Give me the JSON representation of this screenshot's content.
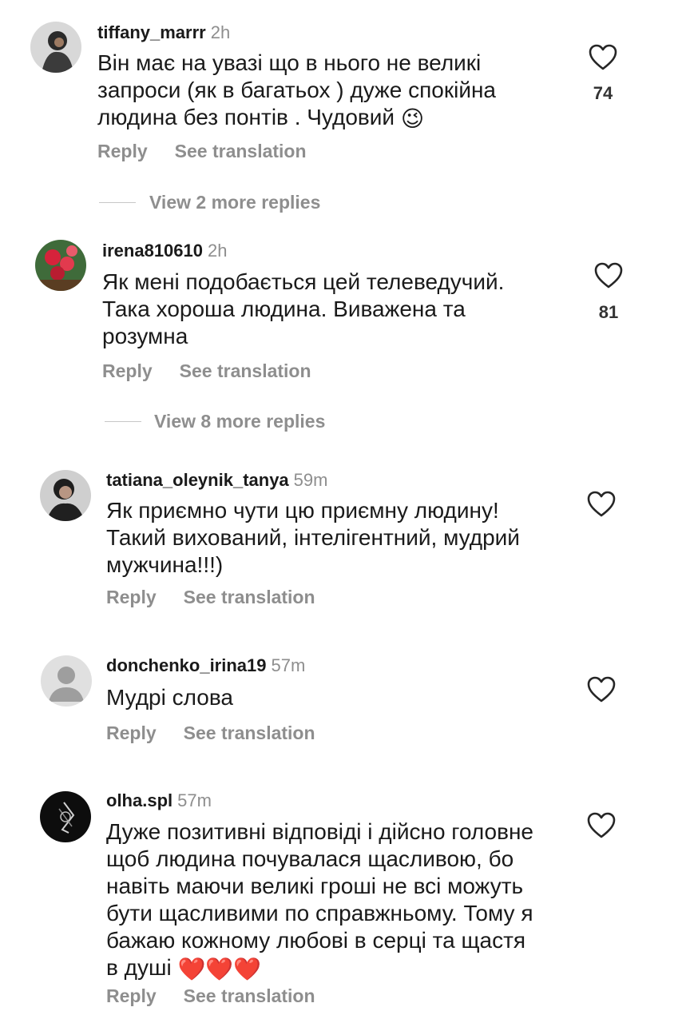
{
  "comments": [
    {
      "username": "tiffany_marrr",
      "time": "2h",
      "lines": [
        "Він має на увазі що в нього не великі",
        "запроси (як в багатьох ) дуже спокійна",
        "людина без понтів .  Чудовий"
      ],
      "emoji": "😉",
      "likes": "74",
      "reply": "Reply",
      "see_translation": "See translation",
      "more_replies": "View 2 more replies"
    },
    {
      "username": "irena810610",
      "time": "2h",
      "lines": [
        "Як мені подобається цей телеведучий.",
        "Така хороша людина. Виважена та",
        "розумна"
      ],
      "likes": "81",
      "reply": "Reply",
      "see_translation": "See translation",
      "more_replies": "View 8 more replies"
    },
    {
      "username": "tatiana_oleynik_tanya",
      "time": "59m",
      "lines": [
        "Як приємно чути цю приємну людину!",
        "Такий вихований, інтелігентний, мудрий",
        "мужчина!!!)"
      ],
      "reply": "Reply",
      "see_translation": "See translation"
    },
    {
      "username": "donchenko_irina19",
      "time": "57m",
      "lines": [
        "Мудрі слова"
      ],
      "reply": "Reply",
      "see_translation": "See translation"
    },
    {
      "username": "olha.spl",
      "time": "57m",
      "lines": [
        "Дуже позитивні відповіді і дійсно головне",
        "щоб людина почувалася щасливою, бо",
        "навіть маючи великі гроші не всі можуть",
        "бути щасливими по справжньому. Тому я",
        "бажаю кожному любові в серці та щастя",
        "в душі"
      ],
      "emoji": "❤️❤️❤️",
      "reply": "Reply",
      "see_translation": "See translation"
    }
  ],
  "colors": {
    "text": "#1a1a1a",
    "secondary": "#8e8e8e",
    "heart_outline": "#262626"
  }
}
